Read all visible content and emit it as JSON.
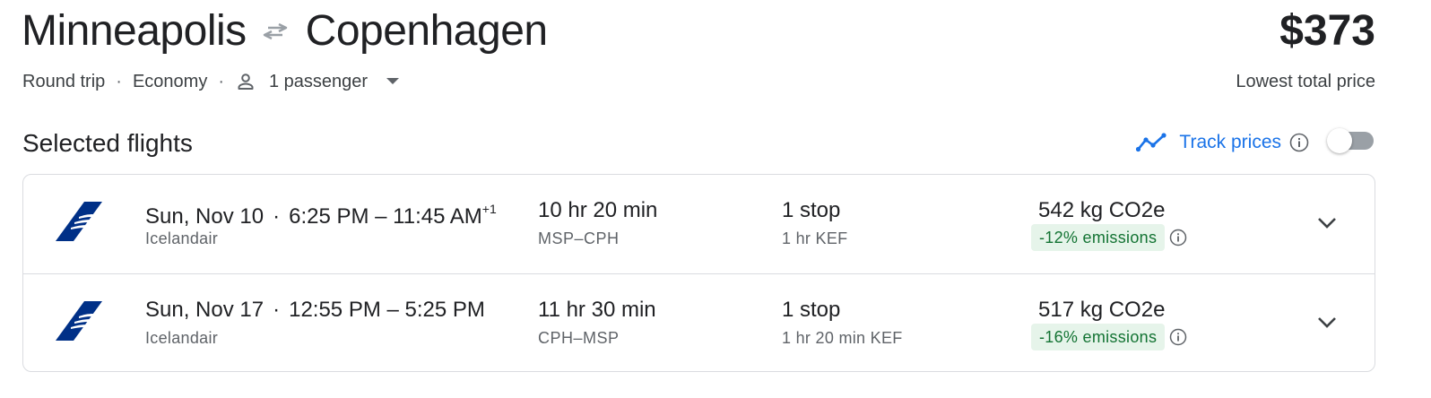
{
  "header": {
    "origin": "Minneapolis",
    "destination": "Copenhagen",
    "price": "$373",
    "price_label": "Lowest total price"
  },
  "meta": {
    "trip_type": "Round trip",
    "cabin": "Economy",
    "passengers": "1 passenger",
    "separator": "·"
  },
  "section": {
    "title": "Selected flights"
  },
  "track": {
    "label": "Track prices",
    "enabled": false
  },
  "flights": [
    {
      "date": "Sun, Nov 10",
      "time_range": "6:25 PM – 11:45 AM",
      "day_offset": "+1",
      "airline": "Icelandair",
      "duration": "10 hr 20 min",
      "route": "MSP–CPH",
      "stops": "1 stop",
      "layover": "1 hr KEF",
      "co2": "542 kg CO2e",
      "emissions": "-12% emissions"
    },
    {
      "date": "Sun, Nov 17",
      "time_range": "12:55 PM – 5:25 PM",
      "day_offset": "",
      "airline": "Icelandair",
      "duration": "11 hr 30 min",
      "route": "CPH–MSP",
      "stops": "1 stop",
      "layover": "1 hr 20 min KEF",
      "co2": "517 kg CO2e",
      "emissions": "-16% emissions"
    }
  ],
  "colors": {
    "accent_blue": "#1a73e8",
    "icelandair_navy": "#003087",
    "emissions_bg": "#e6f4ea",
    "emissions_text": "#137333"
  },
  "icons": {
    "swap": "swap-arrows-icon",
    "person": "person-icon",
    "caret": "caret-down-icon",
    "track": "trend-line-icon",
    "info": "info-icon",
    "chevron": "chevron-down-icon",
    "airline_logo": "icelandair-logo-icon"
  }
}
